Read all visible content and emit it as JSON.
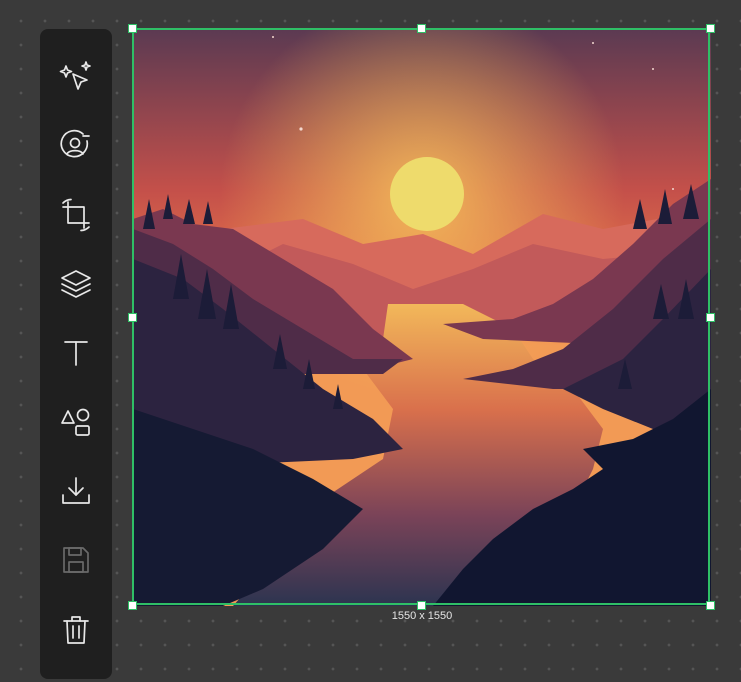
{
  "toolbar": {
    "tools": [
      {
        "icon": "magic-select-icon",
        "state": "enabled"
      },
      {
        "icon": "user-circle-icon",
        "state": "enabled"
      },
      {
        "icon": "crop-rotate-icon",
        "state": "enabled"
      },
      {
        "icon": "layers-icon",
        "state": "enabled"
      },
      {
        "icon": "text-icon",
        "state": "enabled"
      },
      {
        "icon": "shapes-icon",
        "state": "enabled"
      },
      {
        "icon": "download-icon",
        "state": "enabled"
      },
      {
        "icon": "save-icon",
        "state": "disabled"
      },
      {
        "icon": "trash-icon",
        "state": "enabled"
      }
    ]
  },
  "canvas": {
    "selection_color": "#2fbf66",
    "dimensions_label": "1550 x 1550"
  }
}
